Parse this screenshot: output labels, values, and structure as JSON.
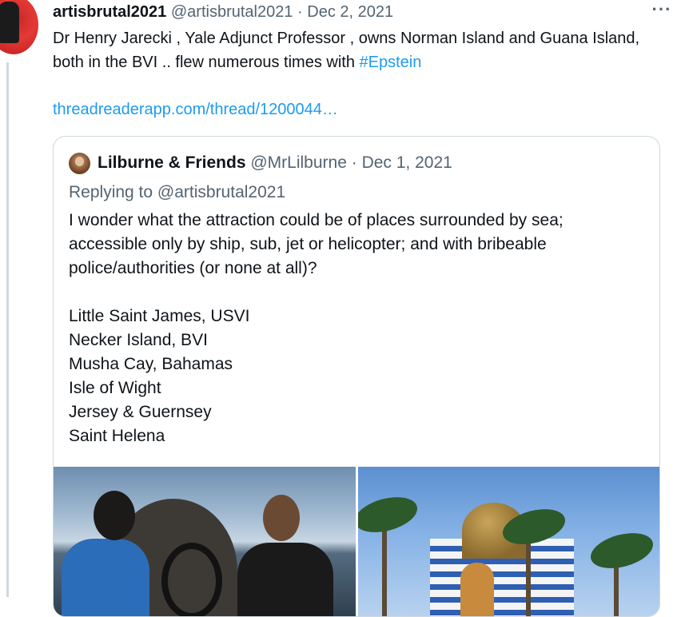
{
  "tweet": {
    "display_name": "artisbrutal2021",
    "handle": "@artisbrutal2021",
    "separator": "·",
    "date": "Dec 2, 2021",
    "more": "···",
    "text_before_hashtag": "Dr Henry Jarecki , Yale Adjunct Professor , owns Norman Island and Guana Island, both in the BVI .. flew numerous times with ",
    "hashtag": "#Epstein",
    "link": "threadreaderapp.com/thread/1200044…"
  },
  "quote": {
    "display_name": "Lilburne & Friends",
    "handle": "@MrLilburne",
    "separator": "·",
    "date": "Dec 1, 2021",
    "replying_to": "Replying to @artisbrutal2021",
    "text": "I wonder what the attraction could be of places surrounded by sea; accessible only by ship, sub, jet or helicopter; and with bribeable police/authorities (or none at all)?",
    "places": [
      "Little Saint James, USVI",
      "Necker Island, BVI",
      "Musha Cay, Bahamas",
      "Isle of Wight",
      "Jersey & Guernsey",
      "Saint Helena"
    ]
  },
  "colors": {
    "link": "#1d9bf0",
    "muted": "#536471",
    "border": "#cfd9de"
  }
}
